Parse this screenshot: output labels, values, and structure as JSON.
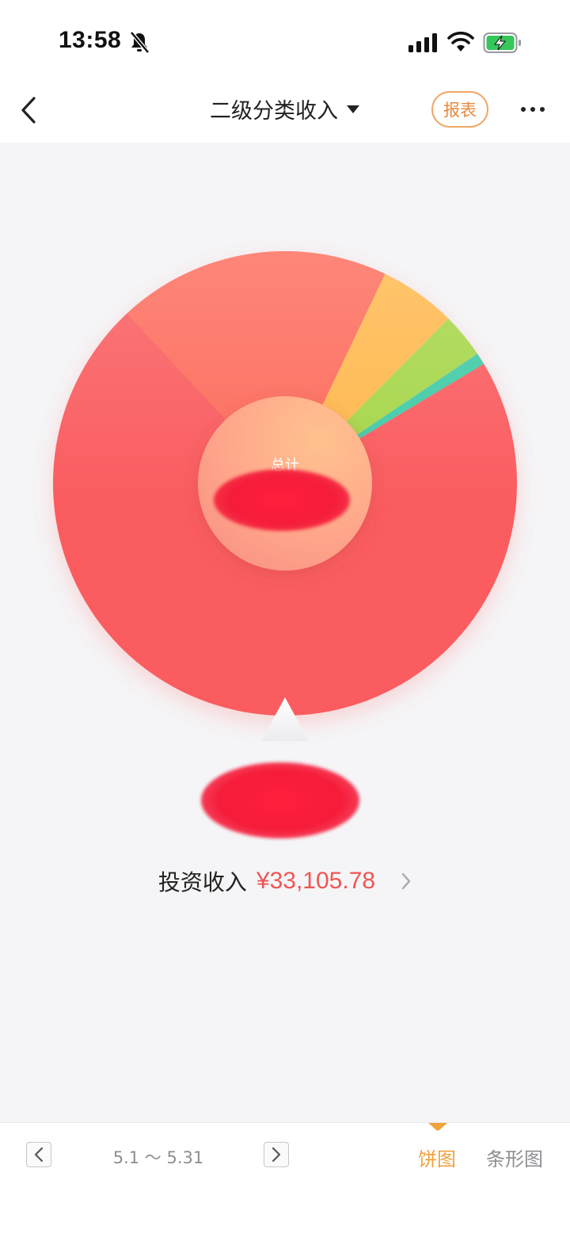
{
  "status_bar": {
    "time": "13:58"
  },
  "nav": {
    "title": "二级分类收入",
    "report_label": "报表"
  },
  "colors": {
    "accent": "#f0a23b",
    "amount": "#ef5553",
    "report_border": "#f0a766"
  },
  "chart_data": {
    "type": "pie",
    "center_label": "总计",
    "slices": [
      {
        "label": "投资收入",
        "value": 33105.78,
        "color": "#fa5b5f"
      },
      {
        "value": 1950,
        "color": "#ffb84d"
      },
      {
        "value": 1140,
        "color": "#a6d64a"
      },
      {
        "value": 300,
        "color": "#3fcaa7"
      }
    ],
    "selected_index": 0,
    "start_angle_deg": 59
  },
  "selected": {
    "category": "投资收入",
    "amount": "¥33,105.78"
  },
  "bottom_bar": {
    "date_range": "5.1 ～ 5.31",
    "tabs": [
      {
        "label": "饼图",
        "active": true
      },
      {
        "label": "条形图",
        "active": false
      }
    ]
  }
}
